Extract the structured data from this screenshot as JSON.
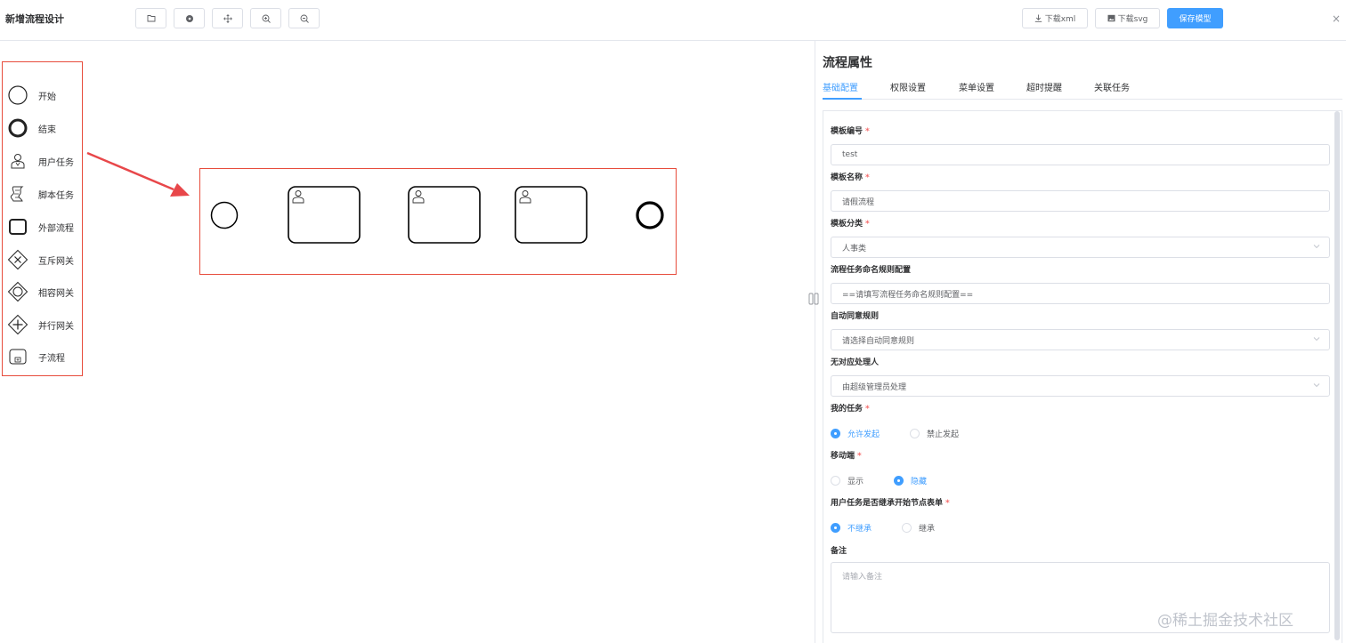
{
  "header": {
    "title": "新增流程设计",
    "tools": [
      {
        "name": "open",
        "glyph": "🗁"
      },
      {
        "name": "center",
        "glyph": "●"
      },
      {
        "name": "move",
        "glyph": "✣"
      },
      {
        "name": "zoom-in",
        "glyph": "⊕"
      },
      {
        "name": "zoom-out",
        "glyph": "⊖"
      }
    ],
    "download_xml": "下载xml",
    "download_svg": "下载svg",
    "save_model": "保存模型",
    "close": "×"
  },
  "palette": [
    {
      "label": "开始",
      "icon": "start-event-icon"
    },
    {
      "label": "结束",
      "icon": "end-event-icon"
    },
    {
      "label": "用户任务",
      "icon": "user-task-icon"
    },
    {
      "label": "脚本任务",
      "icon": "script-task-icon"
    },
    {
      "label": "外部流程",
      "icon": "external-process-icon"
    },
    {
      "label": "互斥网关",
      "icon": "exclusive-gateway-icon"
    },
    {
      "label": "相容网关",
      "icon": "inclusive-gateway-icon"
    },
    {
      "label": "并行网关",
      "icon": "parallel-gateway-icon"
    },
    {
      "label": "子流程",
      "icon": "subprocess-icon"
    }
  ],
  "panel": {
    "title": "流程属性",
    "tabs": [
      "基础配置",
      "权限设置",
      "菜单设置",
      "超时提醒",
      "关联任务"
    ],
    "active_tab": "基础配置",
    "fields": {
      "template_code": {
        "label": "模板编号",
        "value": "test"
      },
      "template_name": {
        "label": "模板名称",
        "value": "请假流程"
      },
      "template_category": {
        "label": "模板分类",
        "value": "人事类"
      },
      "naming_rule": {
        "label": "流程任务命名规则配置",
        "placeholder": "==请填写流程任务命名规则配置=="
      },
      "auto_agree": {
        "label": "自动同意规则",
        "placeholder": "请选择自动同意规则"
      },
      "no_handler": {
        "label": "无对应处理人",
        "value": "由超级管理员处理"
      },
      "my_task": {
        "label": "我的任务",
        "options": [
          "允许发起",
          "禁止发起"
        ],
        "selected": "允许发起"
      },
      "mobile": {
        "label": "移动端",
        "options": [
          "显示",
          "隐藏"
        ],
        "selected": "隐藏"
      },
      "inherit_form": {
        "label": "用户任务是否继承开始节点表单",
        "options": [
          "不继承",
          "继承"
        ],
        "selected": "不继承"
      },
      "remark": {
        "label": "备注",
        "placeholder": "请输入备注"
      }
    },
    "required_mark": "*"
  },
  "watermark": "@稀土掘金技术社区",
  "colors": {
    "accent": "#409eff",
    "highlight_border": "#e74c3c",
    "arrow": "#e8474a"
  }
}
